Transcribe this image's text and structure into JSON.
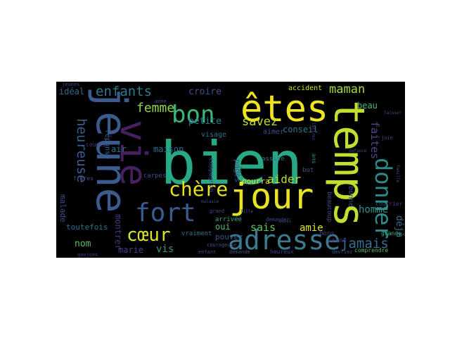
{
  "word_cloud": {
    "background": "#000000",
    "palette": "viridis",
    "words": [
      {
        "text": "bien",
        "color": "#27a986"
      },
      {
        "text": "jeune",
        "color": "#3b5b8c"
      },
      {
        "text": "temps",
        "color": "#c1df2e"
      },
      {
        "text": "êtes",
        "color": "#f0e31f"
      },
      {
        "text": "jour",
        "color": "#e8e423"
      },
      {
        "text": "vie",
        "color": "#46205f"
      },
      {
        "text": "bon",
        "color": "#3bb67a"
      },
      {
        "text": "adresse",
        "color": "#3c7a8e"
      },
      {
        "text": "donner",
        "color": "#2d8a8b"
      },
      {
        "text": "fort",
        "color": "#3a5b8e"
      },
      {
        "text": "chère",
        "color": "#e5e419"
      },
      {
        "text": "cœur",
        "color": "#d9e22a"
      },
      {
        "text": "enfants",
        "color": "#2a7b8c"
      },
      {
        "text": "heureuse",
        "color": "#3b5f8c"
      },
      {
        "text": "femme",
        "color": "#92d448"
      },
      {
        "text": "maman",
        "color": "#a7db3d"
      },
      {
        "text": "jamais",
        "color": "#3a6e8f"
      },
      {
        "text": "homme",
        "color": "#34928b"
      },
      {
        "text": "faites",
        "color": "#4a4a8a"
      },
      {
        "text": "savez",
        "color": "#b8de30"
      },
      {
        "text": "aider",
        "color": "#b8de30"
      },
      {
        "text": "sais",
        "color": "#60c35e"
      },
      {
        "text": "amie",
        "color": "#e0e32a"
      },
      {
        "text": "vis",
        "color": "#3f8f8c"
      },
      {
        "text": "nom",
        "color": "#58bd66"
      },
      {
        "text": "marie",
        "color": "#473c84"
      },
      {
        "text": "petite",
        "color": "#2d7c8c"
      },
      {
        "text": "croire",
        "color": "#3d5089"
      },
      {
        "text": "conseil",
        "color": "#2a778c"
      },
      {
        "text": "déjà",
        "color": "#3b6e8e"
      },
      {
        "text": "beau",
        "color": "#4cb874"
      },
      {
        "text": "idéal",
        "color": "#2f6d8e"
      },
      {
        "text": "pourra",
        "color": "#e3e31f"
      },
      {
        "text": "oui",
        "color": "#55bf6b"
      },
      {
        "text": "pouvez",
        "color": "#35598c"
      },
      {
        "text": "air",
        "color": "#30728c"
      },
      {
        "text": "maison",
        "color": "#2f6b8e"
      },
      {
        "text": "pages",
        "color": "#3b4f8a"
      },
      {
        "text": "montrer",
        "color": "#453781"
      },
      {
        "text": "malade",
        "color": "#3c4f8a"
      },
      {
        "text": "toutefois",
        "color": "#2d708e"
      },
      {
        "text": "visage",
        "color": "#2b758e"
      },
      {
        "text": "aimer",
        "color": "#3b528b"
      },
      {
        "text": "bonne",
        "color": "#3e4a89"
      },
      {
        "text": "accident",
        "color": "#d2e21b"
      },
      {
        "text": "réponse",
        "color": "#31688e"
      },
      {
        "text": "compagnon",
        "color": "#3a528b"
      },
      {
        "text": "assise",
        "color": "#2a788e"
      },
      {
        "text": "vraiment",
        "color": "#2c738e"
      },
      {
        "text": "arrivée",
        "color": "#3aa982"
      },
      {
        "text": "beaucoup",
        "color": "#3e4c8a"
      },
      {
        "text": "grande",
        "color": "#37b878"
      },
      {
        "text": "peine",
        "color": "#45347f"
      },
      {
        "text": "comprendre",
        "color": "#4cc26c"
      },
      {
        "text": "courrier",
        "color": "#414287"
      },
      {
        "text": "bons",
        "color": "#423f85"
      },
      {
        "text": "but",
        "color": "#3d4d8a"
      },
      {
        "text": "ans",
        "color": "#24868e"
      },
      {
        "text": "heureux",
        "color": "#414487"
      },
      {
        "text": "demande",
        "color": "#3a538b"
      },
      {
        "text": "enfant",
        "color": "#3a4d89"
      },
      {
        "text": "anne",
        "color": "#3b518b"
      },
      {
        "text": "couple",
        "color": "#4a3c84"
      },
      {
        "text": "carpes",
        "color": "#3c4f8a"
      },
      {
        "text": "frères",
        "color": "#3e4989"
      },
      {
        "text": "goujons",
        "color": "#433e85"
      },
      {
        "text": "jeunes",
        "color": "#3f4788"
      },
      {
        "text": "courageuse",
        "color": "#3b528b"
      },
      {
        "text": "malasie",
        "color": "#3a518b"
      },
      {
        "text": "grand",
        "color": "#3e4a89"
      },
      {
        "text": "devriez",
        "color": "#3a528b"
      },
      {
        "text": "joie",
        "color": "#3d4f8a"
      },
      {
        "text": "faut",
        "color": "#3f4989"
      },
      {
        "text": "famille",
        "color": "#3c508b"
      },
      {
        "text": "demander",
        "color": "#3e4a89"
      },
      {
        "text": "lettres",
        "color": "#3d4c8a"
      },
      {
        "text": "laisser",
        "color": "#3b528b"
      },
      {
        "text": "fille",
        "color": "#3a538b"
      },
      {
        "text": "enfance",
        "color": "#3e4a89"
      },
      {
        "text": "aussi",
        "color": "#3c4f8a"
      }
    ]
  }
}
